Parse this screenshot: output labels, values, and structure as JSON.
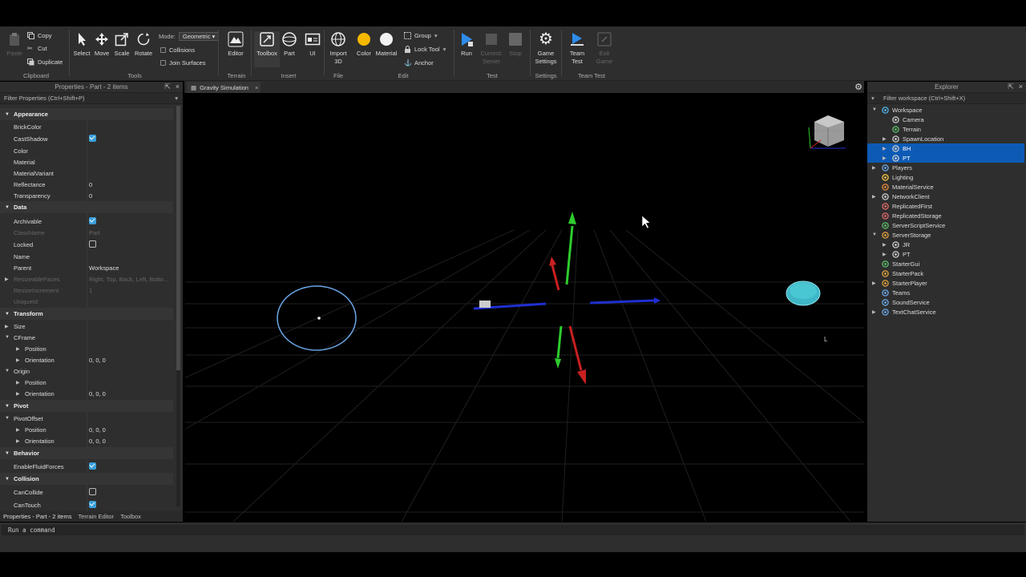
{
  "ribbon": {
    "clipboard": {
      "paste": "Paste",
      "copy": "Copy",
      "cut": "Cut",
      "duplicate": "Duplicate",
      "group_label": "Clipboard"
    },
    "tools": {
      "select": "Select",
      "move": "Move",
      "scale": "Scale",
      "rotate": "Rotate",
      "mode_label": "Mode:",
      "mode_value": "Geometric",
      "collisions": "Collisions",
      "join_surfaces": "Join Surfaces",
      "group_label": "Tools"
    },
    "terrain": {
      "editor": "Editor",
      "group_label": "Terrain"
    },
    "insert": {
      "toolbox": "Toolbox",
      "part": "Part",
      "ui": "UI",
      "group_label": "Insert"
    },
    "file": {
      "import3d": "Import 3D",
      "group_label": "File"
    },
    "edit": {
      "color": "Color",
      "material": "Material",
      "group": "Group",
      "lock_tool": "Lock Tool",
      "anchor": "Anchor",
      "group_label": "Edit"
    },
    "test": {
      "run": "Run",
      "current_server": "Current: Server",
      "stop": "Stop",
      "group_label": "Test"
    },
    "settings": {
      "game_settings": "Game Settings",
      "group_label": "Settings"
    },
    "team_test": {
      "team_test": "Team Test",
      "exit_game": "Exit Game",
      "group_label": "Team Test"
    }
  },
  "properties": {
    "title": "Properties - Part - 2 items",
    "filter_placeholder": "Filter Properties (Ctrl+Shift+P)",
    "sections": {
      "appearance": "Appearance",
      "data": "Data",
      "transform": "Transform",
      "pivot": "Pivot",
      "behavior": "Behavior",
      "collision": "Collision"
    },
    "rows": {
      "brickcolor": {
        "name": "BrickColor",
        "value": ""
      },
      "castshadow": {
        "name": "CastShadow",
        "checked": true
      },
      "color": {
        "name": "Color",
        "value": ""
      },
      "material": {
        "name": "Material",
        "value": ""
      },
      "materialvariant": {
        "name": "MaterialVariant",
        "value": ""
      },
      "reflectance": {
        "name": "Reflectance",
        "value": "0"
      },
      "transparency": {
        "name": "Transparency",
        "value": "0"
      },
      "archivable": {
        "name": "Archivable",
        "checked": true
      },
      "classname": {
        "name": "ClassName",
        "value": "Part"
      },
      "locked": {
        "name": "Locked",
        "checked": false
      },
      "name": {
        "name": "Name",
        "value": ""
      },
      "parent": {
        "name": "Parent",
        "value": "Workspace"
      },
      "resizeablefaces": {
        "name": "ResizeableFaces",
        "value": "Right, Top, Back, Left, Botto..."
      },
      "resizeincrement": {
        "name": "ResizeIncrement",
        "value": "1"
      },
      "uniqueid": {
        "name": "UniqueId",
        "value": ""
      },
      "size": {
        "name": "Size",
        "value": ""
      },
      "cframe": {
        "name": "CFrame",
        "value": ""
      },
      "cframe_position": {
        "name": "Position",
        "value": ""
      },
      "cframe_orientation": {
        "name": "Orientation",
        "value": "0, 0, 0"
      },
      "origin": {
        "name": "Origin",
        "value": ""
      },
      "origin_position": {
        "name": "Position",
        "value": ""
      },
      "origin_orientation": {
        "name": "Orientation",
        "value": "0, 0, 0"
      },
      "pivotoffset": {
        "name": "PivotOffset",
        "value": ""
      },
      "pivot_position": {
        "name": "Position",
        "value": "0, 0, 0"
      },
      "pivot_orientation": {
        "name": "Orientation",
        "value": "0, 0, 0"
      },
      "enablefluidforces": {
        "name": "EnableFluidForces",
        "checked": true
      },
      "cancollide": {
        "name": "CanCollide",
        "checked": false
      },
      "cantouch": {
        "name": "CanTouch",
        "checked": true
      }
    },
    "bottom_tabs": [
      "Properties - Part - 2 items",
      "Terrain Editor",
      "Toolbox"
    ]
  },
  "viewport": {
    "tab_label": "Gravity Simulation",
    "cursor_label": "L"
  },
  "explorer": {
    "title": "Explorer",
    "filter_placeholder": "Filter workspace (Ctrl+Shift+X)",
    "items": [
      {
        "label": "Workspace",
        "icon": "workspace-icon"
      },
      {
        "label": "Camera",
        "icon": "camera-icon"
      },
      {
        "label": "Terrain",
        "icon": "terrain-icon"
      },
      {
        "label": "SpawnLocation",
        "icon": "spawn-icon"
      },
      {
        "label": "BH",
        "icon": "part-icon"
      },
      {
        "label": "PT",
        "icon": "part-icon"
      },
      {
        "label": "Players",
        "icon": "players-icon"
      },
      {
        "label": "Lighting",
        "icon": "lighting-icon"
      },
      {
        "label": "MaterialService",
        "icon": "material-service-icon"
      },
      {
        "label": "NetworkClient",
        "icon": "network-icon"
      },
      {
        "label": "ReplicatedFirst",
        "icon": "replicated-first-icon"
      },
      {
        "label": "ReplicatedStorage",
        "icon": "replicated-storage-icon"
      },
      {
        "label": "ServerScriptService",
        "icon": "server-script-icon"
      },
      {
        "label": "ServerStorage",
        "icon": "server-storage-icon"
      },
      {
        "label": "JR",
        "icon": "part-icon"
      },
      {
        "label": "PT",
        "icon": "part-icon"
      },
      {
        "label": "StarterGui",
        "icon": "starter-gui-icon"
      },
      {
        "label": "StarterPack",
        "icon": "starter-pack-icon"
      },
      {
        "label": "StarterPlayer",
        "icon": "starter-player-icon"
      },
      {
        "label": "Teams",
        "icon": "teams-icon"
      },
      {
        "label": "SoundService",
        "icon": "sound-icon"
      },
      {
        "label": "TextChatService",
        "icon": "text-chat-icon"
      }
    ]
  },
  "command_bar": {
    "placeholder": "Run a command"
  },
  "colors": {
    "accent": "#0d5ab5",
    "checkbox": "#3a9fd8",
    "panel": "#2e2e2e"
  }
}
